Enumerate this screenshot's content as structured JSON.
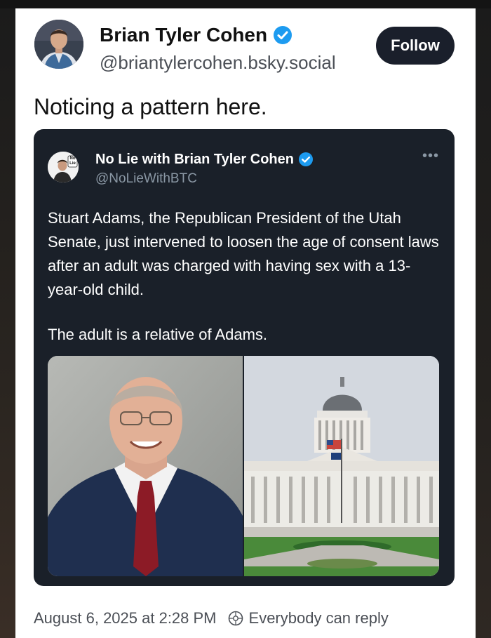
{
  "post": {
    "author_name": "Brian Tyler Cohen",
    "handle": "@briantylercohen.bsky.social",
    "follow_label": "Follow",
    "text": "Noticing a pattern here.",
    "timestamp": "August 6, 2025 at 2:28 PM",
    "reply_setting": "Everybody can reply"
  },
  "quote": {
    "author_name": "No Lie with Brian Tyler Cohen",
    "handle": "@NoLieWithBTC",
    "logo_text": "No Lie",
    "more_label": "•••",
    "paragraphs": [
      "Stuart Adams, the Republican President of the Utah Senate, just intervened to loosen the age of consent laws after an adult was charged with having sex with a 13-year-old child.",
      "The adult is a relative of Adams."
    ]
  },
  "colors": {
    "verified": "#1d9bf0",
    "quote_bg": "#1a2029",
    "follow_bg": "#1a1f2b"
  },
  "icons": [
    "verified-badge-icon",
    "more-options-icon",
    "reply-settings-icon"
  ]
}
